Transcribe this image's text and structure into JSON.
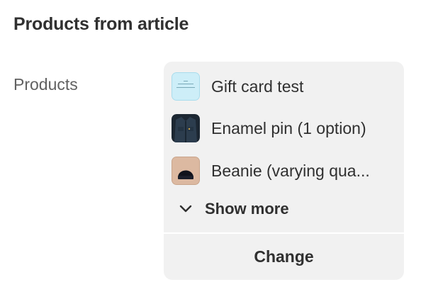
{
  "section": {
    "title": "Products from article"
  },
  "field": {
    "label": "Products"
  },
  "products": [
    {
      "name": "Gift card test",
      "thumbnail": "gift-card-thumbnail"
    },
    {
      "name": "Enamel pin (1 option)",
      "thumbnail": "denim-jacket-thumbnail"
    },
    {
      "name": "Beanie (varying qua...",
      "thumbnail": "beanie-thumbnail"
    }
  ],
  "show_more": {
    "label": "Show more",
    "icon": "chevron-down-icon"
  },
  "actions": {
    "change_label": "Change"
  },
  "colors": {
    "card_background": "#f1f1f1",
    "text_primary": "#303030",
    "text_secondary": "#616161",
    "gift_card_bg": "#cdeef8"
  }
}
